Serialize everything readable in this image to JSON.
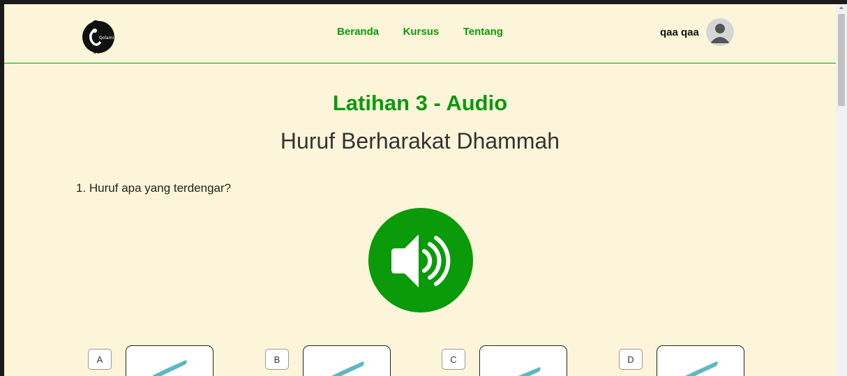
{
  "nav": {
    "items": [
      {
        "label": "Beranda"
      },
      {
        "label": "Kursus"
      },
      {
        "label": "Tentang"
      }
    ]
  },
  "user": {
    "name": "qaa qaa"
  },
  "logo": {
    "text": "Qolami"
  },
  "exercise": {
    "title": "Latihan 3 - Audio",
    "subtitle": "Huruf Berharakat Dhammah"
  },
  "question": {
    "text": "1. Huruf apa yang terdengar?",
    "options": [
      {
        "label": "A"
      },
      {
        "label": "B"
      },
      {
        "label": "C"
      },
      {
        "label": "D"
      }
    ]
  },
  "colors": {
    "brand_green": "#0a9a0a",
    "background": "#fdf5d9",
    "glyph_teal": "#5cb8c4"
  },
  "icons": {
    "audio": "speaker-icon",
    "user": "user-avatar-icon"
  }
}
